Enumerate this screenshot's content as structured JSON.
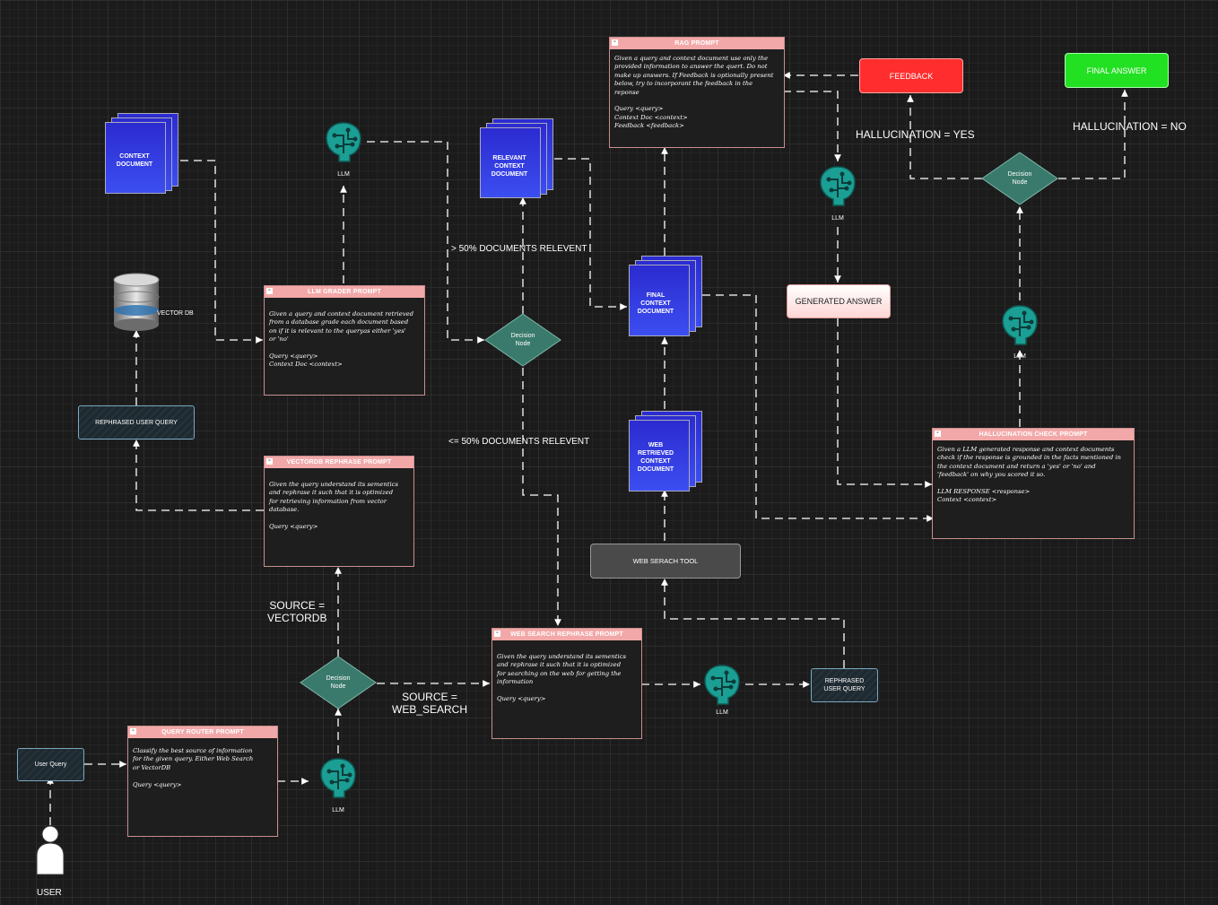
{
  "prompts": {
    "rag": {
      "title": "RAG PROMPT",
      "text": "Given a query and context document use only the\nprovided information to answer the quert. Do not\nmake up answers. If Feedback is optionally present\nbelow, try to incorporant the feedback in the\nreponse\n\nQuery <query>\nContext Doc <context>\nFeedback <feedback>"
    },
    "grader": {
      "title": "LLM GRADER PROMPT",
      "text": "Given a query and context document retrieved\nfrom a database grade each document based\non if it is relevant to the queryas either 'yes'\nor 'no'\n\nQuery <query>\nContext Doc <context>"
    },
    "vectordb": {
      "title": "VECTORDB REPHRASE PROMPT",
      "text": "Given the query understand its sementics\nand rephrase it such that it is optimized\nfor retrieving information from vector\ndatabase.\n\nQuery <query>"
    },
    "websearch": {
      "title": "WEB SEARCH REPHRASE PROMPT",
      "text": "Given the query understand its sementics\nand rephrase it such that it is optimized\nfor searching on the web for getting the\ninformation\n\nQuery <query>"
    },
    "router": {
      "title": "QUERY ROUTER PROMPT",
      "text": "Classify the best source of information\nfor the given query. Either Web Search\nor VectorDB\n\nQuery <query>"
    },
    "hallucination": {
      "title": "HALLUCINATION CHECK PROMPT",
      "text": "Given a LLM generated response and context documents\ncheck if the response is grounded in the facts mentioned in\nthe context document and return a 'yes' or 'no' and\n'feedback' on why you scored it so.\n\nLLM RESPONSE <response>\nContext <context>"
    }
  },
  "documents": {
    "context": "CONTEXT\nDOCUMENT",
    "relevant": "RELEVANT\nCONTEXT\nDOCUMENT",
    "final": "FINAL\nCONTEXT\nDOCUMENT",
    "web": "WEB\nRETRIEVED\nCONTEXT\nDOCUMENT"
  },
  "llm_label": "LLM",
  "vector_db_label": "VECTOR DB",
  "decision_node_label": "Decision\nNode",
  "boxes": {
    "feedback": "FEEDBACK",
    "final_answer": "FINAL ANSWER",
    "generated_answer": "GENERATED ANSWER",
    "web_search_tool": "WEB SERACH TOOL",
    "rephrased_user_query_1": "REPHRASED USER QUERY",
    "rephrased_user_query_2": "REPHRASED\nUSER QUERY",
    "user_query": "User Query",
    "user": "USER"
  },
  "edge_labels": {
    "hallucination_yes": "HALLUCINATION = YES",
    "hallucination_no": "HALLUCINATION = NO",
    "docs_gt50": "> 50% DOCUMENTS RELEVENT",
    "docs_le50": "<= 50% DOCUMENTS RELEVENT",
    "source_vectordb": "SOURCE =\nVECTORDB",
    "source_web": "SOURCE =\nWEB_SEARCH"
  },
  "colors": {
    "prompt_header": "#f2a8a8",
    "feedback": "#ff2d2d",
    "final_answer": "#22e022",
    "llm": "#1b9e94",
    "document": "#3344e0",
    "decision": "#3a7a6c"
  }
}
